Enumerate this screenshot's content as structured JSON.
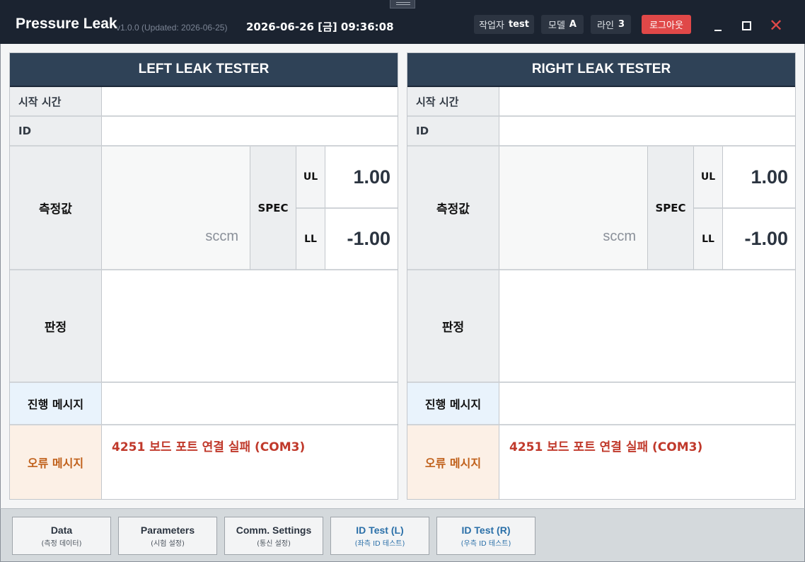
{
  "app": {
    "title": "Pressure Leak",
    "version": "v1.0.0 (Updated: 2026-06-25)",
    "datetime": "2026-06-26 [금] 09:36:08"
  },
  "header": {
    "worker_label": "작업자",
    "worker_value": "test",
    "model_label": "모델",
    "model_value": "A",
    "line_label": "라인",
    "line_value": "3",
    "logout_label": "로그아웃",
    "icons": [
      "minimize-icon",
      "maximize-icon",
      "close-icon"
    ],
    "close_color": "#e04848"
  },
  "left": {
    "title": "LEFT LEAK TESTER",
    "start_time_label": "시작 시간",
    "start_time_value": "",
    "id_label": "ID",
    "id_value": "",
    "measure_label": "측정값",
    "measure_value": "",
    "unit": "sccm",
    "spec_label": "SPEC",
    "ul_label": "UL",
    "ul_value": "1.00",
    "ll_label": "LL",
    "ll_value": "-1.00",
    "judge_label": "판정",
    "judge_value": "",
    "progress_label": "진행 메시지",
    "progress_value": "",
    "error_label": "오류 메시지",
    "error_value": "4251 보드 포트 연결 실패 (COM3)"
  },
  "right": {
    "title": "RIGHT LEAK TESTER",
    "start_time_label": "시작 시간",
    "start_time_value": "",
    "id_label": "ID",
    "id_value": "",
    "measure_label": "측정값",
    "measure_value": "",
    "unit": "sccm",
    "spec_label": "SPEC",
    "ul_label": "UL",
    "ul_value": "1.00",
    "ll_label": "LL",
    "ll_value": "-1.00",
    "judge_label": "판정",
    "judge_value": "",
    "progress_label": "진행 메시지",
    "progress_value": "",
    "error_label": "오류 메시지",
    "error_value": "4251 보드 포트 연결 실패 (COM3)"
  },
  "toolbar": {
    "buttons": [
      {
        "label": "Data",
        "sub": "(측정 데이터)"
      },
      {
        "label": "Parameters",
        "sub": "(시험 설정)"
      },
      {
        "label": "Comm. Settings",
        "sub": "(통신 설정)"
      },
      {
        "label": "ID Test (L)",
        "sub": "(좌측 ID 테스트)"
      },
      {
        "label": "ID Test (R)",
        "sub": "(우측 ID 테스트)"
      }
    ]
  },
  "colors": {
    "titlebar": "#1b2330",
    "panel_header": "#2f4257",
    "error_text": "#c0392b",
    "logout": "#e04848",
    "id_test_text": "#2a6fa8"
  }
}
